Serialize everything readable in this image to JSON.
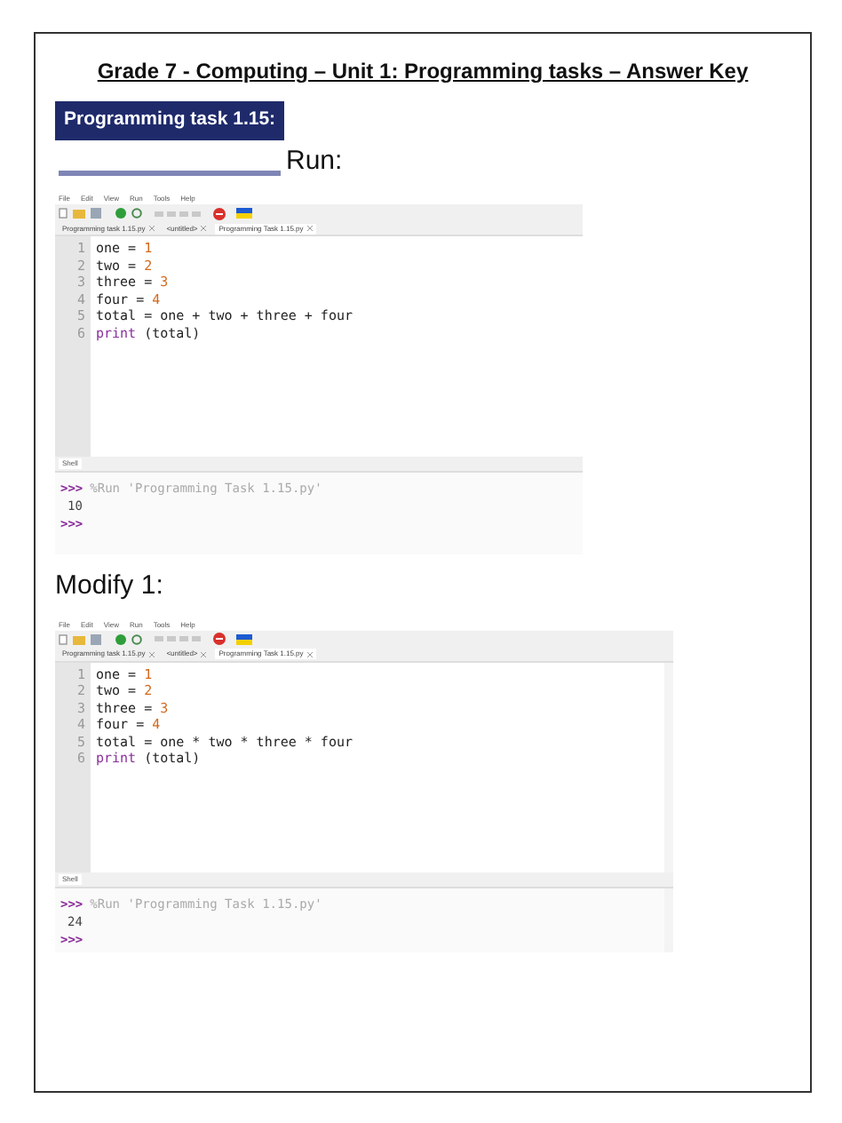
{
  "header": {
    "title": "Grade 7 - Computing – Unit 1: Programming tasks – Answer Key"
  },
  "task_banner": {
    "label": "Programming task 1.15:"
  },
  "sections": [
    {
      "heading": "Run:",
      "ide": {
        "scrollbar": false,
        "menu": [
          "File",
          "Edit",
          "View",
          "Run",
          "Tools",
          "Help"
        ],
        "tabs": [
          {
            "label": "Programming task 1.15.py",
            "selected": false
          },
          {
            "label": "<untitled>",
            "selected": false
          },
          {
            "label": "Programming Task 1.15.py",
            "selected": true
          }
        ],
        "line_numbers": [
          "1",
          "2",
          "3",
          "4",
          "5",
          "6"
        ],
        "code": [
          [
            {
              "t": "one = ",
              "kind": "plain"
            },
            {
              "t": "1",
              "kind": "number"
            }
          ],
          [
            {
              "t": "two = ",
              "kind": "plain"
            },
            {
              "t": "2",
              "kind": "number"
            }
          ],
          [
            {
              "t": "three = ",
              "kind": "plain"
            },
            {
              "t": "3",
              "kind": "number"
            }
          ],
          [
            {
              "t": "four = ",
              "kind": "plain"
            },
            {
              "t": "4",
              "kind": "number"
            }
          ],
          [
            {
              "t": "total = one + two + three + four",
              "kind": "plain"
            }
          ],
          [
            {
              "t": "print",
              "kind": "builtin"
            },
            {
              "t": " (total)",
              "kind": "plain"
            }
          ]
        ],
        "shell_tab": "Shell",
        "shell": [
          {
            "kind": "command",
            "prompt": ">>>",
            "text": "%Run 'Programming Task 1.15.py'"
          },
          {
            "kind": "output",
            "text": "10"
          },
          {
            "kind": "prompt",
            "prompt": ">>>"
          }
        ]
      }
    },
    {
      "heading": "Modify 1:",
      "ide": {
        "scrollbar": true,
        "menu": [
          "File",
          "Edit",
          "View",
          "Run",
          "Tools",
          "Help"
        ],
        "tabs": [
          {
            "label": "Programming task 1.15.py",
            "selected": false
          },
          {
            "label": "<untitled>",
            "selected": false
          },
          {
            "label": "Programming Task 1.15.py",
            "selected": true
          }
        ],
        "line_numbers": [
          "1",
          "2",
          "3",
          "4",
          "5",
          "6"
        ],
        "code": [
          [
            {
              "t": "one = ",
              "kind": "plain"
            },
            {
              "t": "1",
              "kind": "number"
            }
          ],
          [
            {
              "t": "two = ",
              "kind": "plain"
            },
            {
              "t": "2",
              "kind": "number"
            }
          ],
          [
            {
              "t": "three = ",
              "kind": "plain"
            },
            {
              "t": "3",
              "kind": "number"
            }
          ],
          [
            {
              "t": "four = ",
              "kind": "plain"
            },
            {
              "t": "4",
              "kind": "number"
            }
          ],
          [
            {
              "t": "total = one * two * three * four",
              "kind": "plain"
            }
          ],
          [
            {
              "t": "print",
              "kind": "builtin"
            },
            {
              "t": " (total)",
              "kind": "plain"
            }
          ]
        ],
        "shell_tab": "Shell",
        "shell": [
          {
            "kind": "command",
            "prompt": ">>>",
            "text": "%Run 'Programming Task 1.15.py'"
          },
          {
            "kind": "output",
            "text": "24"
          },
          {
            "kind": "prompt",
            "prompt": ">>>"
          }
        ]
      }
    }
  ]
}
